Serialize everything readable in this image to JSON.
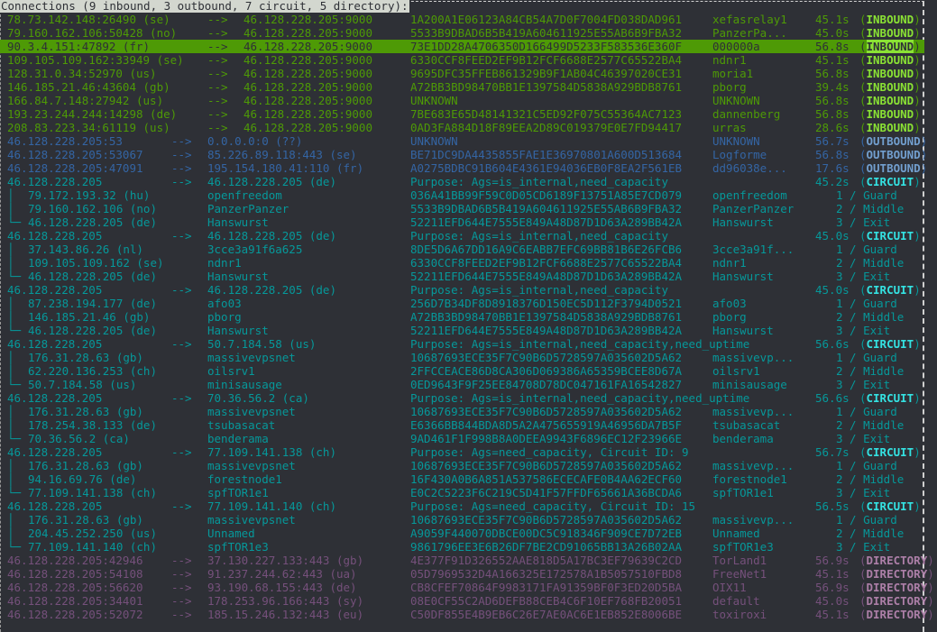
{
  "header": {
    "title": "Connections (9 inbound, 3 outbound, 7 circuit, 5 directory):"
  },
  "arrow": "-->",
  "colors": {
    "inbound": "#4e9a06",
    "inbound_label": "#8ae234",
    "outbound": "#3465a4",
    "outbound_label": "#729fcf",
    "circuit": "#06989a",
    "circuit_label": "#34e2e2",
    "directory": "#75507b",
    "directory_label": "#ad7fa8",
    "selected_bg": "#4e9a06",
    "background": "#2e3036"
  },
  "rows": [
    {
      "type": "inbound",
      "src": "78.73.142.148:26490 (se)",
      "dst": "46.128.228.205:9000",
      "fp": "1A200A1E06123A84CB54A7D0F7004FD038DAD961",
      "nick": "xefasrelay1",
      "time": "45.1s",
      "label": "INBOUND"
    },
    {
      "type": "inbound",
      "src": "79.160.162.106:50428 (no)",
      "dst": "46.128.228.205:9000",
      "fp": "5533B9DBAD6B5B419A604611925E55AB6B9FBA32",
      "nick": "PanzerPa...",
      "time": "45.0s",
      "label": "INBOUND"
    },
    {
      "type": "inbound",
      "selected": true,
      "src": "90.3.4.151:47892 (fr)",
      "dst": "46.128.228.205:9000",
      "fp": "73E1DD28A4706350D166499D5233F583536E360F",
      "nick": "000000a",
      "time": "56.8s",
      "label": "INBOUND"
    },
    {
      "type": "inbound",
      "src": "109.105.109.162:33949 (se)",
      "dst": "46.128.228.205:9000",
      "fp": "6330CCF8FEED2EF9B12FCF6688E2577C65522BA4",
      "nick": "ndnr1",
      "time": "45.1s",
      "label": "INBOUND"
    },
    {
      "type": "inbound",
      "src": "128.31.0.34:52970 (us)",
      "dst": "46.128.228.205:9000",
      "fp": "9695DFC35FFEB861329B9F1AB04C46397020CE31",
      "nick": "moria1",
      "time": "56.8s",
      "label": "INBOUND"
    },
    {
      "type": "inbound",
      "src": "146.185.21.46:43604 (gb)",
      "dst": "46.128.228.205:9000",
      "fp": "A72BB3BD98470BB1E1397584D5838A929BDB8761",
      "nick": "pborg",
      "time": "39.4s",
      "label": "INBOUND"
    },
    {
      "type": "inbound",
      "src": "166.84.7.148:27942 (us)",
      "dst": "46.128.228.205:9000",
      "fp": "UNKNOWN",
      "nick": "UNKNOWN",
      "time": "56.8s",
      "label": "INBOUND"
    },
    {
      "type": "inbound",
      "src": "193.23.244.244:14298 (de)",
      "dst": "46.128.228.205:9000",
      "fp": "7BE683E65D48141321C5ED92F075C55364AC7123",
      "nick": "dannenberg",
      "time": "56.8s",
      "label": "INBOUND"
    },
    {
      "type": "inbound",
      "src": "208.83.223.34:61119 (us)",
      "dst": "46.128.228.205:9000",
      "fp": "0AD3FA884D18F89EEA2D89C019379E0E7FD94417",
      "nick": "urras",
      "time": "28.6s",
      "label": "INBOUND"
    },
    {
      "type": "outbound",
      "src": "46.128.228.205:53",
      "dst": "0.0.0.0:0 (??)",
      "fp": "UNKNOWN",
      "nick": "UNKNOWN",
      "time": "56.7s",
      "label": "OUTBOUND"
    },
    {
      "type": "outbound",
      "src": "46.128.228.205:53067",
      "dst": "85.226.89.118:443 (se)",
      "fp": "BE71DC9DA4435855FAE1E36970801A600D513684",
      "nick": "Logforme",
      "time": "56.8s",
      "label": "OUTBOUND"
    },
    {
      "type": "outbound",
      "src": "46.128.228.205:47091",
      "dst": "195.154.180.41:110 (fr)",
      "fp": "A0275BDBC91B604E4361E94036EB0F8EA2F561EB",
      "nick": "dd96038e...",
      "time": "17.6s",
      "label": "OUTBOUND"
    },
    {
      "type": "circuit",
      "src": "46.128.228.205",
      "dst": "46.128.228.205 (de)",
      "purpose": "Purpose: Ags=is_internal,need_capacity",
      "time": "45.2s",
      "label": "CIRCUIT"
    },
    {
      "type": "hop",
      "tree": "│",
      "addr": "79.172.193.32 (hu)",
      "relay": "openfreedom",
      "fp": "036A41BB99F59C0D05CD6189F13751A85E7CD079",
      "nick": "openfreedom",
      "position": "1 / Guard"
    },
    {
      "type": "hop",
      "tree": "│",
      "addr": "79.160.162.106 (no)",
      "relay": "PanzerPanzer",
      "fp": "5533B9DBAD6B5B419A604611925E55AB6B9FBA32",
      "nick": "PanzerPanzer",
      "position": "2 / Middle"
    },
    {
      "type": "hop",
      "tree": "└─",
      "addr": "46.128.228.205 (de)",
      "relay": "Hanswurst",
      "fp": "52211EFD644E7555E849A48D87D1D63A289BB42A",
      "nick": "Hanswurst",
      "position": "3 / Exit"
    },
    {
      "type": "circuit",
      "src": "46.128.228.205",
      "dst": "46.128.228.205 (de)",
      "purpose": "Purpose: Ags=is_internal,need_capacity",
      "time": "45.0s",
      "label": "CIRCUIT"
    },
    {
      "type": "hop",
      "tree": "│",
      "addr": "37.143.86.26 (nl)",
      "relay": "3cce3a91f6a625",
      "fp": "8DE5D6A67DD16A9C6EABB7EFC69BB81B6E26FCB6",
      "nick": "3cce3a91f...",
      "position": "1 / Guard"
    },
    {
      "type": "hop",
      "tree": "│",
      "addr": "109.105.109.162 (se)",
      "relay": "ndnr1",
      "fp": "6330CCF8FEED2EF9B12FCF6688E2577C65522BA4",
      "nick": "ndnr1",
      "position": "2 / Middle"
    },
    {
      "type": "hop",
      "tree": "└─",
      "addr": "46.128.228.205 (de)",
      "relay": "Hanswurst",
      "fp": "52211EFD644E7555E849A48D87D1D63A289BB42A",
      "nick": "Hanswurst",
      "position": "3 / Exit"
    },
    {
      "type": "circuit",
      "src": "46.128.228.205",
      "dst": "46.128.228.205 (de)",
      "purpose": "Purpose: Ags=is_internal,need_capacity",
      "time": "45.0s",
      "label": "CIRCUIT"
    },
    {
      "type": "hop",
      "tree": "│",
      "addr": "87.238.194.177 (de)",
      "relay": "afo03",
      "fp": "256D7B34DF8D8918376D150EC5D112F3794D0521",
      "nick": "afo03",
      "position": "1 / Guard"
    },
    {
      "type": "hop",
      "tree": "│",
      "addr": "146.185.21.46 (gb)",
      "relay": "pborg",
      "fp": "A72BB3BD98470BB1E1397584D5838A929BDB8761",
      "nick": "pborg",
      "position": "2 / Middle"
    },
    {
      "type": "hop",
      "tree": "└─",
      "addr": "46.128.228.205 (de)",
      "relay": "Hanswurst",
      "fp": "52211EFD644E7555E849A48D87D1D63A289BB42A",
      "nick": "Hanswurst",
      "position": "3 / Exit"
    },
    {
      "type": "circuit",
      "src": "46.128.228.205",
      "dst": "50.7.184.58 (us)",
      "purpose": "Purpose: Ags=is_internal,need_capacity,need_uptime",
      "time": "56.6s",
      "label": "CIRCUIT"
    },
    {
      "type": "hop",
      "tree": "│",
      "addr": "176.31.28.63 (gb)",
      "relay": "massivevpsnet",
      "fp": "10687693ECE35F7C90B6D5728597A035602D5A62",
      "nick": "massivevp...",
      "position": "1 / Guard"
    },
    {
      "type": "hop",
      "tree": "│",
      "addr": "62.220.136.253 (ch)",
      "relay": "oilsrv1",
      "fp": "2FFCCEACE86D8CA306D069386A65359BCEE8D67A",
      "nick": "oilsrv1",
      "position": "2 / Middle"
    },
    {
      "type": "hop",
      "tree": "└─",
      "addr": "50.7.184.58 (us)",
      "relay": "minisausage",
      "fp": "0ED9643F9F25EE84708D78DC047161FA16542827",
      "nick": "minisausage",
      "position": "3 / Exit"
    },
    {
      "type": "circuit",
      "src": "46.128.228.205",
      "dst": "70.36.56.2 (ca)",
      "purpose": "Purpose: Ags=is_internal,need_capacity,need_uptime",
      "time": "56.6s",
      "label": "CIRCUIT"
    },
    {
      "type": "hop",
      "tree": "│",
      "addr": "176.31.28.63 (gb)",
      "relay": "massivevpsnet",
      "fp": "10687693ECE35F7C90B6D5728597A035602D5A62",
      "nick": "massivevp...",
      "position": "1 / Guard"
    },
    {
      "type": "hop",
      "tree": "│",
      "addr": "178.254.38.133 (de)",
      "relay": "tsubasacat",
      "fp": "E6366BB844BDA8D5A2A475655919A46956DA7B5F",
      "nick": "tsubasacat",
      "position": "2 / Middle"
    },
    {
      "type": "hop",
      "tree": "└─",
      "addr": "70.36.56.2 (ca)",
      "relay": "benderama",
      "fp": "9AD461F1F998B8A0DEEA9943F6896EC12F23966E",
      "nick": "benderama",
      "position": "3 / Exit"
    },
    {
      "type": "circuit",
      "src": "46.128.228.205",
      "dst": "77.109.141.138 (ch)",
      "purpose": "Purpose: Ags=need_capacity, Circuit ID: 9",
      "time": "56.7s",
      "label": "CIRCUIT"
    },
    {
      "type": "hop",
      "tree": "│",
      "addr": "176.31.28.63 (gb)",
      "relay": "massivevpsnet",
      "fp": "10687693ECE35F7C90B6D5728597A035602D5A62",
      "nick": "massivevp...",
      "position": "1 / Guard"
    },
    {
      "type": "hop",
      "tree": "│",
      "addr": "94.16.69.76 (de)",
      "relay": "forestnode1",
      "fp": "16F430A0B6A851A537586ECECAFE0B4AA62ECF60",
      "nick": "forestnode1",
      "position": "2 / Middle"
    },
    {
      "type": "hop",
      "tree": "└─",
      "addr": "77.109.141.138 (ch)",
      "relay": "spfTOR1e1",
      "fp": "E0C2C5223F6C219C5D41F57FFDF65661A36BCDA6",
      "nick": "spfTOR1e1",
      "position": "3 / Exit"
    },
    {
      "type": "circuit",
      "src": "46.128.228.205",
      "dst": "77.109.141.140 (ch)",
      "purpose": "Purpose: Ags=need_capacity, Circuit ID: 15",
      "time": "56.5s",
      "label": "CIRCUIT"
    },
    {
      "type": "hop",
      "tree": "│",
      "addr": "176.31.28.63 (gb)",
      "relay": "massivevpsnet",
      "fp": "10687693ECE35F7C90B6D5728597A035602D5A62",
      "nick": "massivevp...",
      "position": "1 / Guard"
    },
    {
      "type": "hop",
      "tree": "│",
      "addr": "204.45.252.250 (us)",
      "relay": "Unnamed",
      "fp": "A9059F440070DBCE00DC5C918346F909CE7D72EB",
      "nick": "Unnamed",
      "position": "2 / Middle"
    },
    {
      "type": "hop",
      "tree": "└─",
      "addr": "77.109.141.140 (ch)",
      "relay": "spfTOR1e3",
      "fp": "9861796EE3E6B26DF7BE2CD91065BB13A26B02AA",
      "nick": "spfTOR1e3",
      "position": "3 / Exit"
    },
    {
      "type": "directory",
      "src": "46.128.228.205:42946",
      "dst": "37.130.227.133:443 (gb)",
      "fp": "4E377F91D326552AAE818D5A17BC3EF79639C2CD",
      "nick": "TorLand1",
      "time": "56.9s",
      "label": "DIRECTORY"
    },
    {
      "type": "directory",
      "src": "46.128.228.205:54108",
      "dst": "91.237.244.62:443 (ua)",
      "fp": "05D7969532D4A166325E172578A1B5057510FBD8",
      "nick": "FreeNet1",
      "time": "45.1s",
      "label": "DIRECTORY"
    },
    {
      "type": "directory",
      "src": "46.128.228.205:56620",
      "dst": "93.190.68.155:443 (de)",
      "fp": "CB8CFEF70864F9983171FA91359BF0F3ED20D5BA",
      "nick": "OIX11",
      "time": "56.9s",
      "label": "DIRECTORY"
    },
    {
      "type": "directory",
      "src": "46.128.228.205:34401",
      "dst": "178.253.96.166:443 (sy)",
      "fp": "08E0CF55C2AD6DEFB88CEB4C6F10EF768FB20051",
      "nick": "default",
      "time": "45.0s",
      "label": "DIRECTORY"
    },
    {
      "type": "directory",
      "src": "46.128.228.205:52072",
      "dst": "185.15.246.132:443 (eu)",
      "fp": "C50DF855E4B9EB6C26E7AE0AC6E1EB852E8006BE",
      "nick": "toxiroxi",
      "time": "45.1s",
      "label": "DIRECTORY"
    }
  ]
}
